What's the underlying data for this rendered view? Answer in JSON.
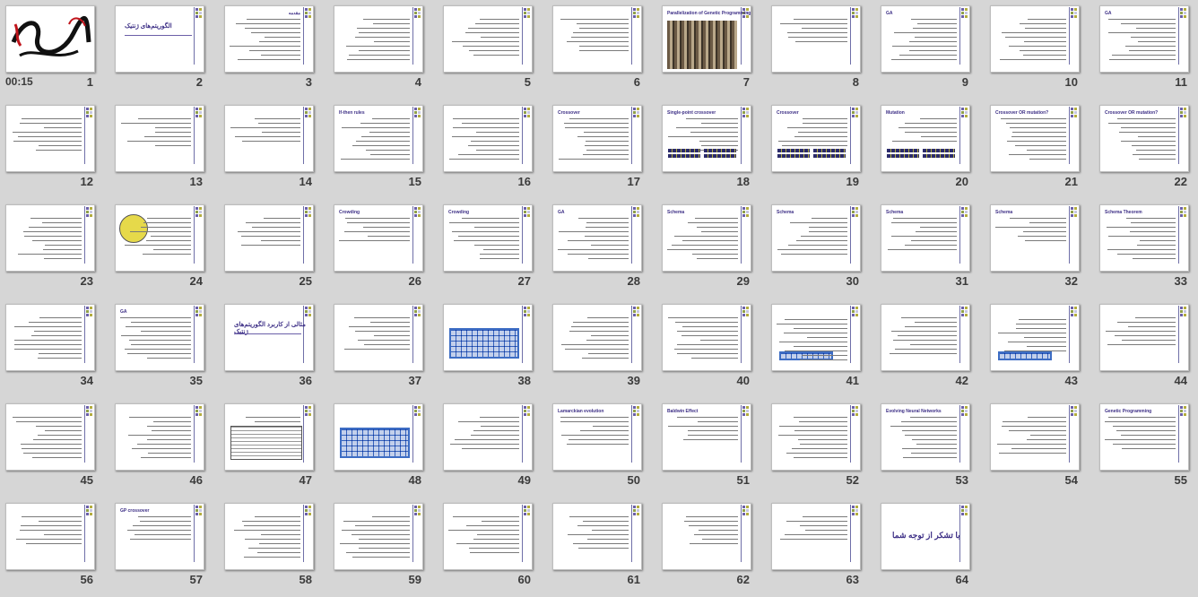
{
  "app": "PowerPoint Slide Sorter",
  "slide1_timing": "00:15",
  "slides": [
    {
      "n": "1",
      "title": "",
      "kind": "calligraphy"
    },
    {
      "n": "2",
      "title": "الگوریتم‌های ژنتیک",
      "kind": "titleslide"
    },
    {
      "n": "3",
      "title": "مقدمه",
      "kind": "text"
    },
    {
      "n": "4",
      "title": "",
      "kind": "text"
    },
    {
      "n": "5",
      "title": "",
      "kind": "text"
    },
    {
      "n": "6",
      "title": "",
      "kind": "text"
    },
    {
      "n": "7",
      "title": "Parallelization of Genetic Programming",
      "kind": "library"
    },
    {
      "n": "8",
      "title": "",
      "kind": "text"
    },
    {
      "n": "9",
      "title": "GA",
      "kind": "text"
    },
    {
      "n": "10",
      "title": "",
      "kind": "text"
    },
    {
      "n": "11",
      "title": "GA",
      "kind": "text"
    },
    {
      "n": "12",
      "title": "",
      "kind": "text"
    },
    {
      "n": "13",
      "title": "",
      "kind": "text"
    },
    {
      "n": "14",
      "title": "",
      "kind": "diagram"
    },
    {
      "n": "15",
      "title": "If-then rules",
      "kind": "text"
    },
    {
      "n": "16",
      "title": "",
      "kind": "text"
    },
    {
      "n": "17",
      "title": "Crossover",
      "kind": "text"
    },
    {
      "n": "18",
      "title": "Single-point crossover",
      "kind": "bits"
    },
    {
      "n": "19",
      "title": "Crossover",
      "kind": "bits"
    },
    {
      "n": "20",
      "title": "Mutation",
      "kind": "bits"
    },
    {
      "n": "21",
      "title": "Crossover OR mutation?",
      "kind": "text"
    },
    {
      "n": "22",
      "title": "Crossover OR mutation?",
      "kind": "text"
    },
    {
      "n": "23",
      "title": "",
      "kind": "text"
    },
    {
      "n": "24",
      "title": "",
      "kind": "wheel"
    },
    {
      "n": "25",
      "title": "",
      "kind": "text"
    },
    {
      "n": "26",
      "title": "Crowding",
      "kind": "graph"
    },
    {
      "n": "27",
      "title": "Crowding",
      "kind": "text"
    },
    {
      "n": "28",
      "title": "GA",
      "kind": "text"
    },
    {
      "n": "29",
      "title": "Schema",
      "kind": "text"
    },
    {
      "n": "30",
      "title": "Schema",
      "kind": "text"
    },
    {
      "n": "31",
      "title": "Schema",
      "kind": "text"
    },
    {
      "n": "32",
      "title": "Schema",
      "kind": "text"
    },
    {
      "n": "33",
      "title": "Schema Theorem",
      "kind": "text"
    },
    {
      "n": "34",
      "title": "",
      "kind": "text"
    },
    {
      "n": "35",
      "title": "GA",
      "kind": "text"
    },
    {
      "n": "36",
      "title": "مثالی از کاربرد الگوریتم‌های ژنتیک",
      "kind": "titleslide"
    },
    {
      "n": "37",
      "title": "",
      "kind": "text"
    },
    {
      "n": "38",
      "title": "",
      "kind": "keyboard"
    },
    {
      "n": "39",
      "title": "",
      "kind": "text"
    },
    {
      "n": "40",
      "title": "",
      "kind": "text"
    },
    {
      "n": "41",
      "title": "",
      "kind": "keyboard-small"
    },
    {
      "n": "42",
      "title": "",
      "kind": "text"
    },
    {
      "n": "43",
      "title": "",
      "kind": "keyboard-small"
    },
    {
      "n": "44",
      "title": "",
      "kind": "text"
    },
    {
      "n": "45",
      "title": "",
      "kind": "text"
    },
    {
      "n": "46",
      "title": "",
      "kind": "text"
    },
    {
      "n": "47",
      "title": "",
      "kind": "table"
    },
    {
      "n": "48",
      "title": "",
      "kind": "keyboard"
    },
    {
      "n": "49",
      "title": "",
      "kind": "text"
    },
    {
      "n": "50",
      "title": "Lamarckian evolution",
      "kind": "text"
    },
    {
      "n": "51",
      "title": "Baldwin Effect",
      "kind": "text"
    },
    {
      "n": "52",
      "title": "",
      "kind": "text"
    },
    {
      "n": "53",
      "title": "Evolving Neural Networks",
      "kind": "text"
    },
    {
      "n": "54",
      "title": "",
      "kind": "text"
    },
    {
      "n": "55",
      "title": "Genetic Programming",
      "kind": "tree"
    },
    {
      "n": "56",
      "title": "",
      "kind": "text"
    },
    {
      "n": "57",
      "title": "GP crossover",
      "kind": "tree"
    },
    {
      "n": "58",
      "title": "",
      "kind": "bars"
    },
    {
      "n": "59",
      "title": "",
      "kind": "text"
    },
    {
      "n": "60",
      "title": "",
      "kind": "text"
    },
    {
      "n": "61",
      "title": "",
      "kind": "text"
    },
    {
      "n": "62",
      "title": "",
      "kind": "text"
    },
    {
      "n": "63",
      "title": "",
      "kind": "text"
    },
    {
      "n": "64",
      "title": "با تشکر از توجه شما",
      "kind": "thanks"
    }
  ]
}
